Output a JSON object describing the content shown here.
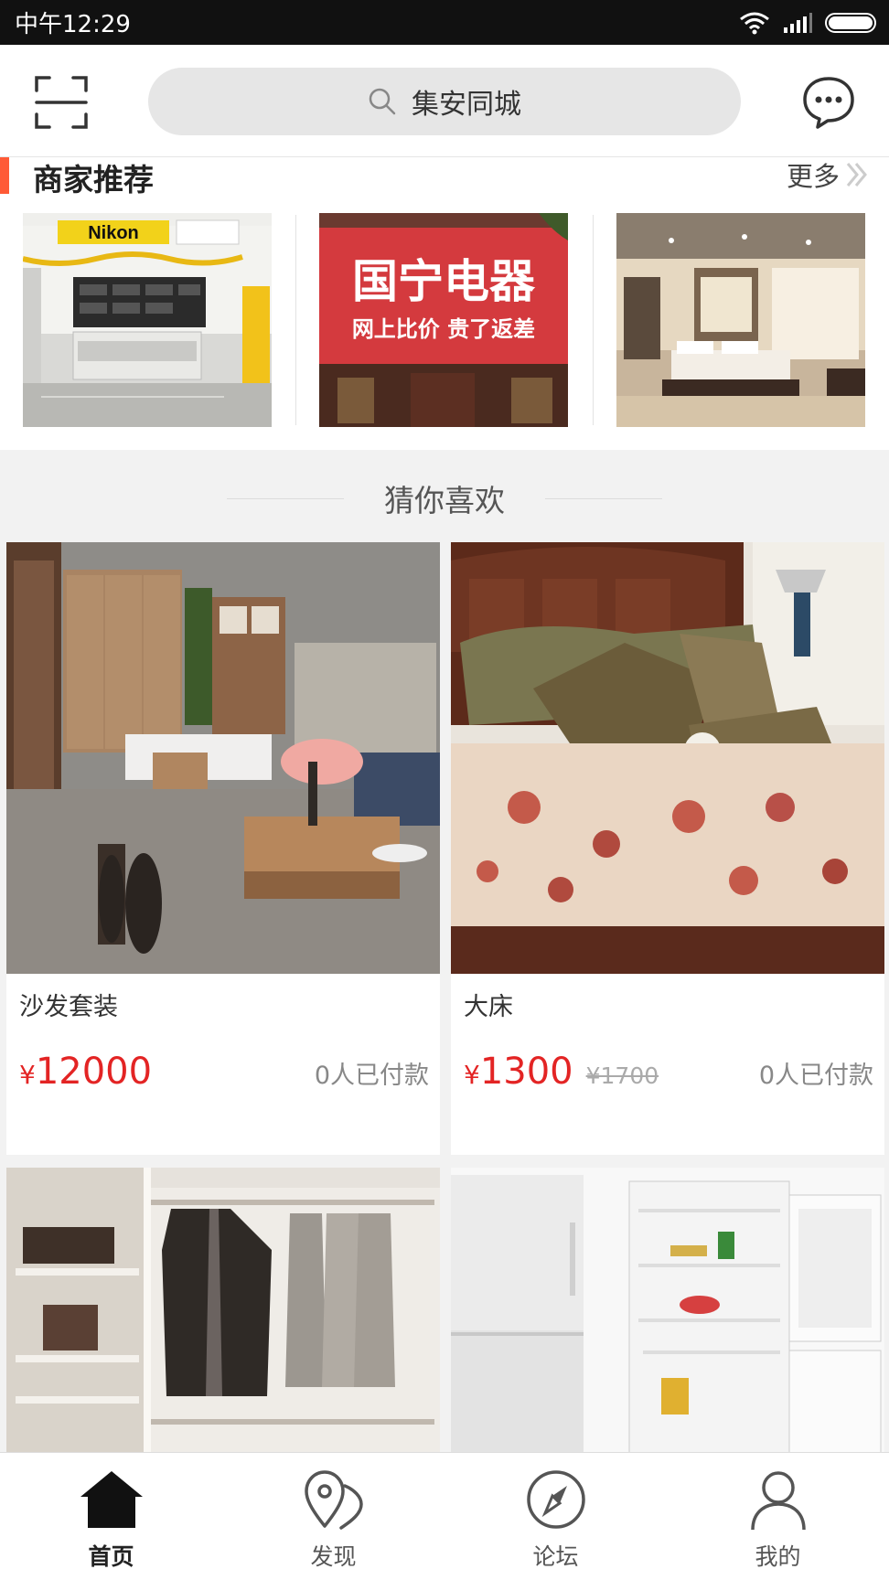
{
  "status_bar": {
    "time": "中午12:29",
    "battery_level": 1.0
  },
  "header": {
    "search_text": "集安同城"
  },
  "merchants": {
    "title": "商家推荐",
    "more_label": "更多",
    "shops": [
      {
        "sign_brand": "Nikon"
      },
      {
        "sign_title": "国宁电器",
        "sign_slogan": "网上比价 贵了返差"
      },
      {}
    ]
  },
  "guess": {
    "title": "猜你喜欢"
  },
  "products": [
    {
      "name": "沙发套装",
      "currency": "¥",
      "price": "12000",
      "original_price": "",
      "paid": "0人已付款"
    },
    {
      "name": "大床",
      "currency": "¥",
      "price": "1300",
      "original_price": "¥1700",
      "paid": "0人已付款"
    },
    {
      "name": "",
      "currency": "",
      "price": "",
      "original_price": "",
      "paid": ""
    },
    {
      "name": "",
      "currency": "",
      "price": "",
      "original_price": "",
      "paid": ""
    }
  ],
  "bottom_nav": [
    {
      "label": "首页",
      "icon": "home-icon",
      "active": true
    },
    {
      "label": "发现",
      "icon": "discover-map-icon",
      "active": false
    },
    {
      "label": "论坛",
      "icon": "compass-icon",
      "active": false
    },
    {
      "label": "我的",
      "icon": "user-icon",
      "active": false
    }
  ],
  "colors": {
    "accent": "#ff5a36",
    "price": "#e32424",
    "status_bar": "#111111"
  }
}
